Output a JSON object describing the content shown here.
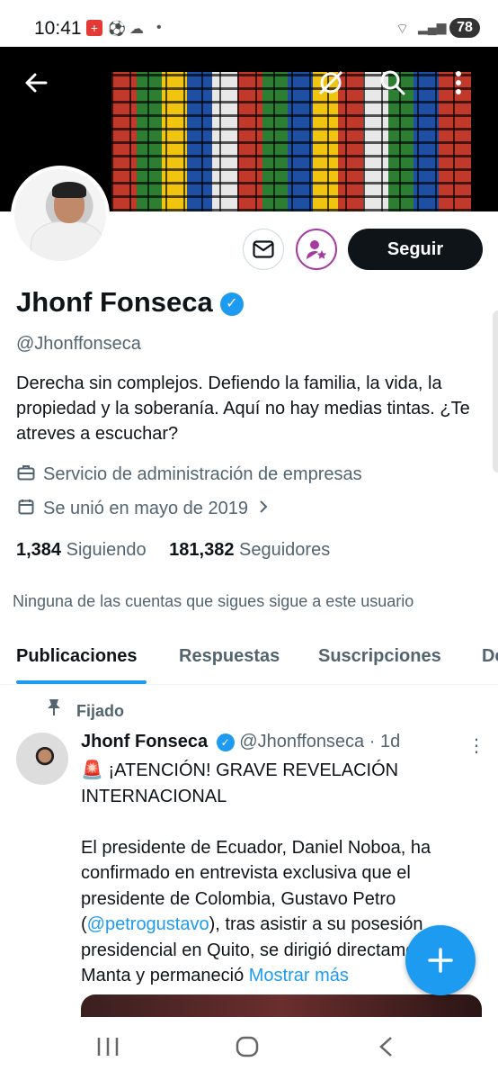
{
  "status_bar": {
    "time": "10:41",
    "battery": "78",
    "icons": [
      "swiss-flag-icon",
      "soccer-ball-icon",
      "cloud-icon",
      "dot-icon",
      "wifi-icon",
      "signal-icon"
    ]
  },
  "header": {
    "back_icon": "arrow-left-icon",
    "action_icons": [
      "hide-icon",
      "search-icon",
      "more-vertical-icon"
    ]
  },
  "profile": {
    "name": "Jhonf Fonseca",
    "verified": true,
    "handle": "@Jhonffonseca",
    "bio": "Derecha sin complejos. Defiendo la familia, la vida, la propiedad y la soberanía. Aquí no hay medias tintas. ¿Te atreves a escuchar?",
    "category": "Servicio de administración de empresas",
    "joined": "Se unió en mayo de 2019",
    "following_count": "1,384",
    "following_label": "Siguiendo",
    "followers_count": "181,382",
    "followers_label": "Seguidores",
    "no_mutuals": "Ninguna de las cuentas que sigues sigue a este usuario",
    "follow_button": "Seguir"
  },
  "tabs": [
    "Publicaciones",
    "Respuestas",
    "Suscripciones",
    "De"
  ],
  "active_tab": "Publicaciones",
  "pinned_label": "Fijado",
  "tweet": {
    "name": "Jhonf Fonseca",
    "handle": "@Jhonffonseca",
    "time": "· 1d",
    "line1": "¡ATENCIÓN! GRAVE REVELACIÓN INTERNACIONAL",
    "body_before_mention": "El presidente de Ecuador, Daniel Noboa, ha confirmado en entrevista exclusiva que el presidente de Colombia, Gustavo Petro (",
    "mention": "@petrogustavo",
    "body_after_mention": "), tras asistir a su posesión presidencial en Quito, se dirigió directamente a Manta y permaneció ",
    "show_more": "Mostrar más"
  },
  "colors": {
    "accent": "#1d9bf0",
    "text": "#0f1419",
    "muted": "#536471",
    "follow_bg": "#0f1419",
    "subscribe_ring": "#a63aa3"
  }
}
